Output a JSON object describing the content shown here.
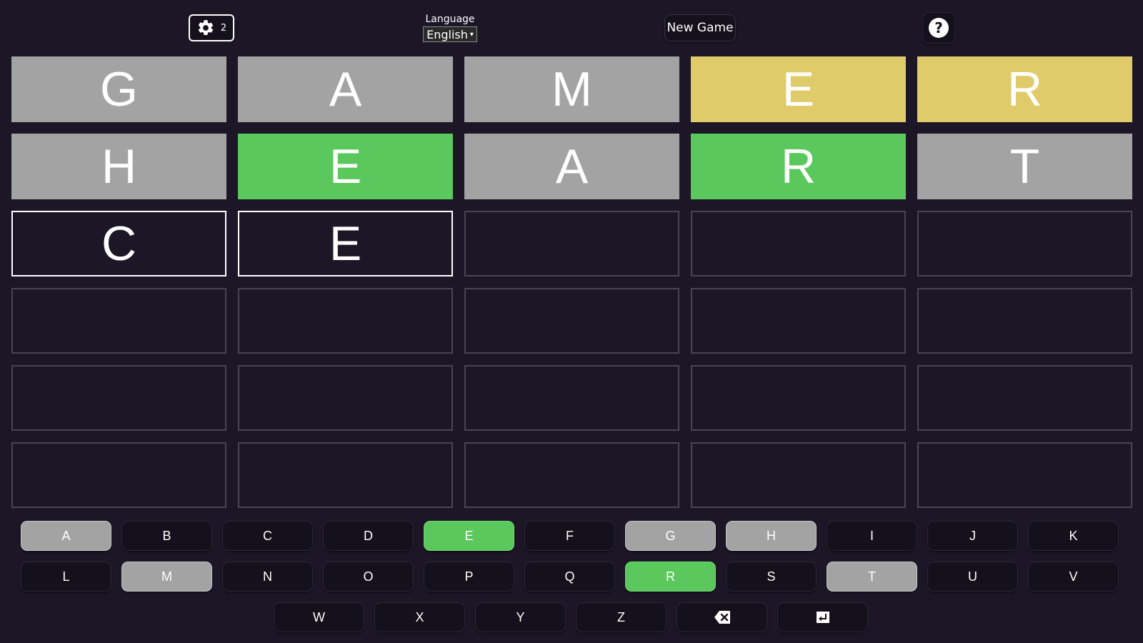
{
  "header": {
    "settings_count": "2",
    "language_label": "Language",
    "language_value": "English",
    "new_game_label": "New Game",
    "help_glyph": "?",
    "settings_icon": "gear-icon",
    "help_icon": "question-circle-icon"
  },
  "colors": {
    "background": "#1c1626",
    "absent": "#a3a3a3",
    "present": "#e0cb6a",
    "correct": "#5ac85d",
    "empty_border": "#4a4452",
    "typed_border": "#ffffff"
  },
  "board": {
    "rows": [
      [
        {
          "letter": "G",
          "state": "absent"
        },
        {
          "letter": "A",
          "state": "absent"
        },
        {
          "letter": "M",
          "state": "absent"
        },
        {
          "letter": "E",
          "state": "present"
        },
        {
          "letter": "R",
          "state": "present"
        }
      ],
      [
        {
          "letter": "H",
          "state": "absent"
        },
        {
          "letter": "E",
          "state": "correct"
        },
        {
          "letter": "A",
          "state": "absent"
        },
        {
          "letter": "R",
          "state": "correct"
        },
        {
          "letter": "T",
          "state": "absent"
        }
      ],
      [
        {
          "letter": "C",
          "state": "typed"
        },
        {
          "letter": "E",
          "state": "typed"
        },
        {
          "letter": "",
          "state": "empty"
        },
        {
          "letter": "",
          "state": "empty"
        },
        {
          "letter": "",
          "state": "empty"
        }
      ],
      [
        {
          "letter": "",
          "state": "empty"
        },
        {
          "letter": "",
          "state": "empty"
        },
        {
          "letter": "",
          "state": "empty"
        },
        {
          "letter": "",
          "state": "empty"
        },
        {
          "letter": "",
          "state": "empty"
        }
      ],
      [
        {
          "letter": "",
          "state": "empty"
        },
        {
          "letter": "",
          "state": "empty"
        },
        {
          "letter": "",
          "state": "empty"
        },
        {
          "letter": "",
          "state": "empty"
        },
        {
          "letter": "",
          "state": "empty"
        }
      ],
      [
        {
          "letter": "",
          "state": "empty"
        },
        {
          "letter": "",
          "state": "empty"
        },
        {
          "letter": "",
          "state": "empty"
        },
        {
          "letter": "",
          "state": "empty"
        },
        {
          "letter": "",
          "state": "empty"
        }
      ]
    ]
  },
  "keyboard": {
    "rows": [
      [
        {
          "label": "A",
          "state": "absent"
        },
        {
          "label": "B",
          "state": "unused"
        },
        {
          "label": "C",
          "state": "unused"
        },
        {
          "label": "D",
          "state": "unused"
        },
        {
          "label": "E",
          "state": "correct"
        },
        {
          "label": "F",
          "state": "unused"
        },
        {
          "label": "G",
          "state": "absent"
        },
        {
          "label": "H",
          "state": "absent"
        },
        {
          "label": "I",
          "state": "unused"
        },
        {
          "label": "J",
          "state": "unused"
        },
        {
          "label": "K",
          "state": "unused"
        }
      ],
      [
        {
          "label": "L",
          "state": "unused"
        },
        {
          "label": "M",
          "state": "absent"
        },
        {
          "label": "N",
          "state": "unused"
        },
        {
          "label": "O",
          "state": "unused"
        },
        {
          "label": "P",
          "state": "unused"
        },
        {
          "label": "Q",
          "state": "unused"
        },
        {
          "label": "R",
          "state": "correct"
        },
        {
          "label": "S",
          "state": "unused"
        },
        {
          "label": "T",
          "state": "absent"
        },
        {
          "label": "U",
          "state": "unused"
        },
        {
          "label": "V",
          "state": "unused"
        }
      ],
      [
        {
          "label": "W",
          "state": "unused"
        },
        {
          "label": "X",
          "state": "unused"
        },
        {
          "label": "Y",
          "state": "unused"
        },
        {
          "label": "Z",
          "state": "unused"
        },
        {
          "label": "",
          "state": "unused",
          "icon": "backspace-icon"
        },
        {
          "label": "",
          "state": "unused",
          "icon": "enter-icon"
        }
      ]
    ]
  }
}
